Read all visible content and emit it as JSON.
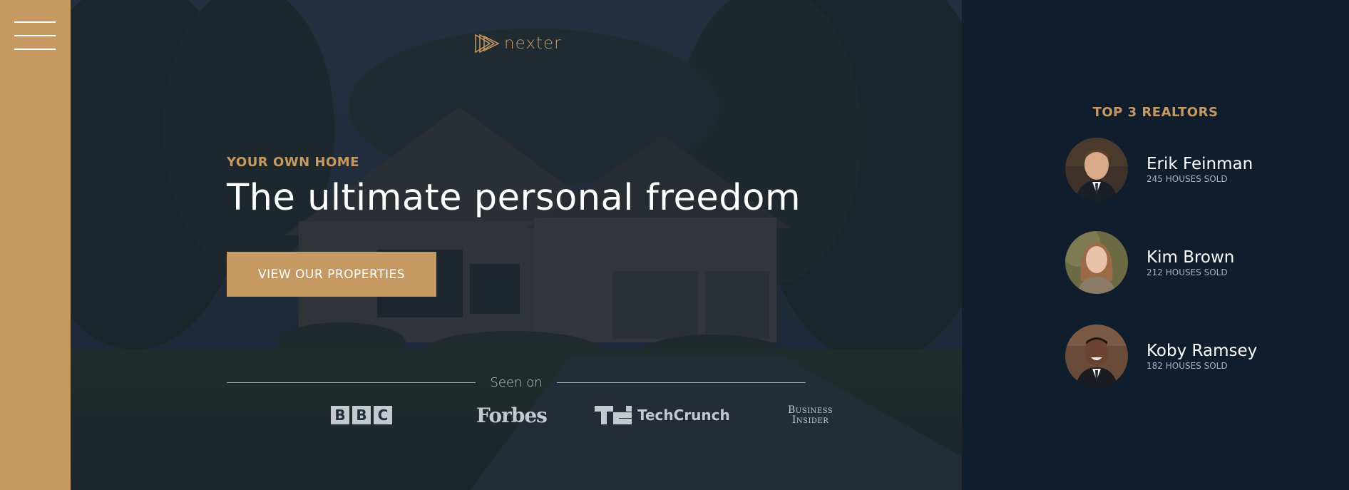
{
  "colors": {
    "primary": "#c69963",
    "dark": "#101d2c",
    "light_text": "#ffffff",
    "muted_text": "#aab2bc"
  },
  "sidebar": {
    "menu_icon": "hamburger-menu-icon"
  },
  "header": {
    "logo": {
      "text": "nexter",
      "icon": "triangle-logo-icon"
    },
    "sub_heading": "Your own home",
    "heading": "The ultimate personal freedom",
    "cta_label": "View our properties",
    "seen_on_label": "Seen on",
    "press": [
      {
        "name": "BBC",
        "letters": [
          "B",
          "B",
          "C"
        ]
      },
      {
        "name": "Forbes"
      },
      {
        "name": "TechCrunch",
        "mark": "TC"
      },
      {
        "name_line1": "Business",
        "name_line2": "Insider"
      }
    ]
  },
  "realtors": {
    "title": "Top 3 Realtors",
    "items": [
      {
        "name": "Erik Feinman",
        "sold": "245 houses sold"
      },
      {
        "name": "Kim Brown",
        "sold": "212 houses sold"
      },
      {
        "name": "Koby Ramsey",
        "sold": "182 houses sold"
      }
    ]
  }
}
